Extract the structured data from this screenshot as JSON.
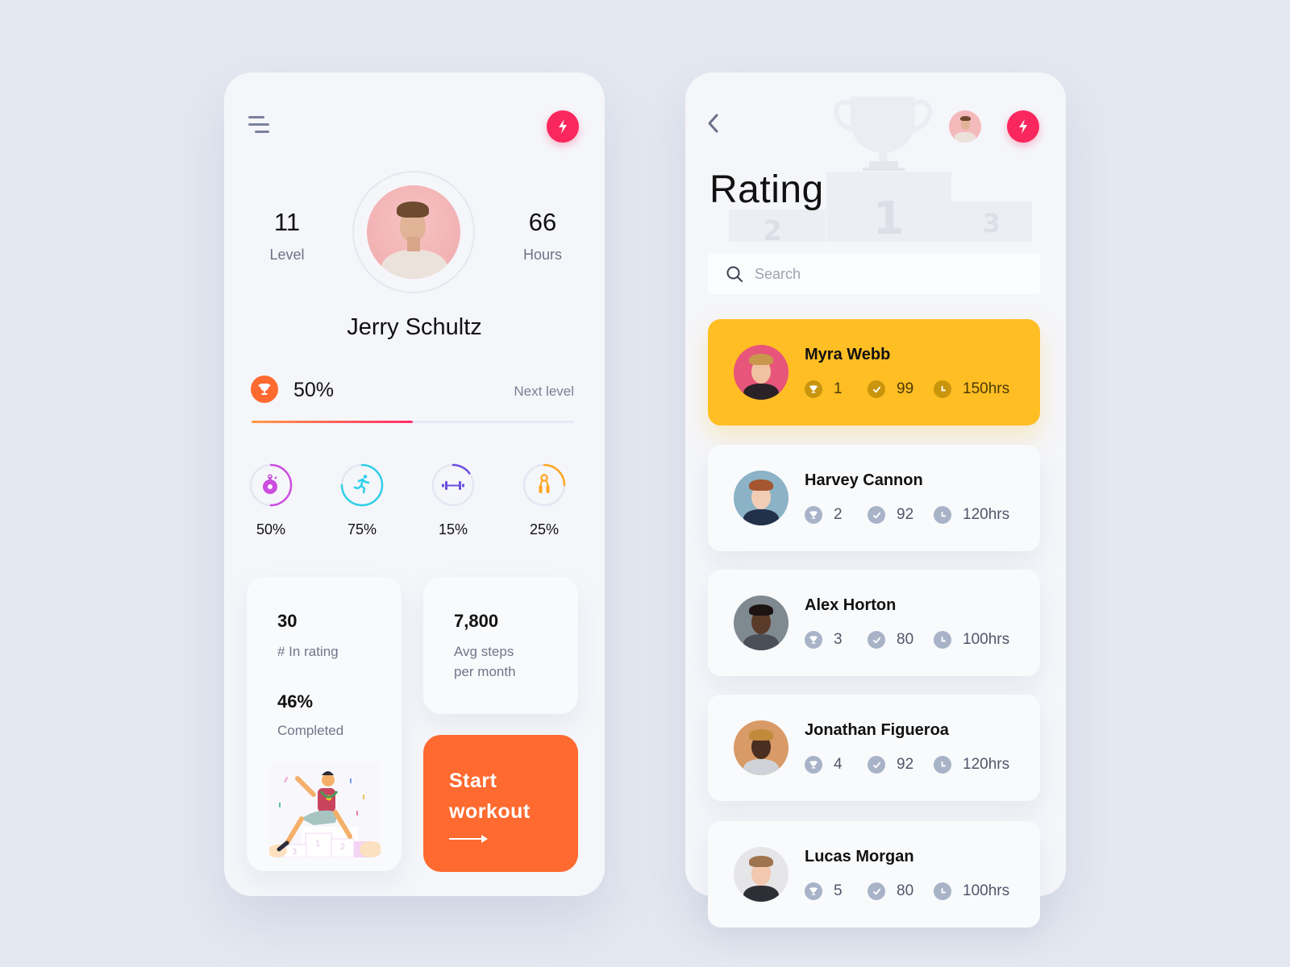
{
  "profile": {
    "level_value": "11",
    "level_label": "Level",
    "hours_value": "66",
    "hours_label": "Hours",
    "name": "Jerry Schultz",
    "progress_text": "50%",
    "progress_fraction": 0.5,
    "next_level_label": "Next level",
    "activities": [
      {
        "icon": "stopwatch-icon",
        "percent_label": "50%",
        "fraction": 0.5,
        "color": "#cc4de0"
      },
      {
        "icon": "running-icon",
        "percent_label": "75%",
        "fraction": 0.75,
        "color": "#2fd0e8"
      },
      {
        "icon": "dumbbell-icon",
        "percent_label": "15%",
        "fraction": 0.15,
        "color": "#6c4ee0"
      },
      {
        "icon": "hand-grip-icon",
        "percent_label": "25%",
        "fraction": 0.25,
        "color": "#ffa51f"
      }
    ],
    "rating_card": {
      "rank_value": "30",
      "rank_label": "# In rating",
      "completed_value": "46%",
      "completed_label": "Completed"
    },
    "steps_card": {
      "value": "7,800",
      "label_line1": "Avg steps",
      "label_line2": "per month"
    },
    "workout_button": {
      "line1": "Start",
      "line2": "workout"
    }
  },
  "rating": {
    "title": "Rating",
    "search_placeholder": "Search",
    "podium_labels": [
      "2",
      "1",
      "3"
    ],
    "users": [
      {
        "name": "Myra Webb",
        "rank": "1",
        "score": "99",
        "hours": "150hrs",
        "highlight": true
      },
      {
        "name": "Harvey Cannon",
        "rank": "2",
        "score": "92",
        "hours": "120hrs",
        "highlight": false
      },
      {
        "name": "Alex Horton",
        "rank": "3",
        "score": "80",
        "hours": "100hrs",
        "highlight": false
      },
      {
        "name": "Jonathan Figueroa",
        "rank": "4",
        "score": "92",
        "hours": "120hrs",
        "highlight": false
      },
      {
        "name": "Lucas Morgan",
        "rank": "5",
        "score": "80",
        "hours": "100hrs",
        "highlight": false
      }
    ]
  },
  "colors": {
    "accent_pink": "#f9275d",
    "accent_orange": "#ff6a30",
    "highlight_yellow": "#ffbe24",
    "background": "#e4e8f0",
    "card": "#f9fafc"
  }
}
